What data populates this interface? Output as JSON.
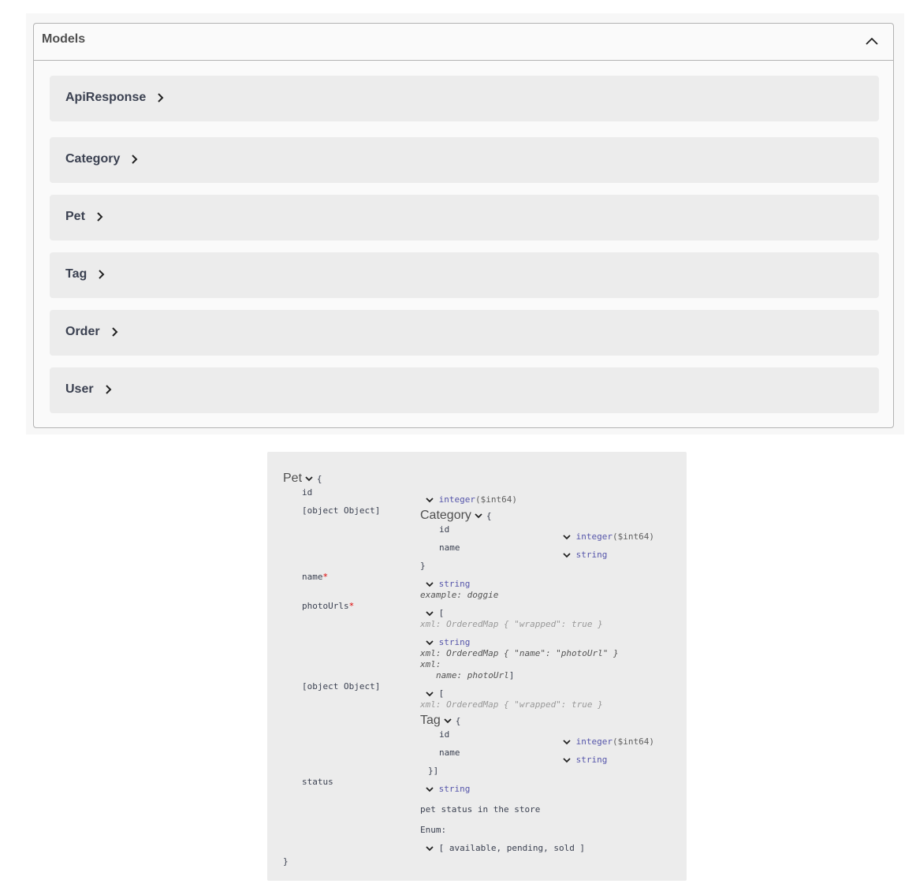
{
  "models_section": {
    "title": "Models",
    "items": [
      {
        "label": "ApiResponse"
      },
      {
        "label": "Category"
      },
      {
        "label": "Pet"
      },
      {
        "label": "Tag"
      },
      {
        "label": "Order"
      },
      {
        "label": "User"
      }
    ]
  },
  "pet_schema": {
    "title": "Pet",
    "open_brace": "{",
    "close_brace": "}",
    "properties": {
      "id": {
        "name": "id",
        "type": "integer",
        "format": "($int64)"
      },
      "category": {
        "name": {
          "name": "name",
          "type": "string"
        },
        "model_title": "Category",
        "open_brace": "{",
        "close_brace": "}",
        "id": {
          "name": "id",
          "type": "integer",
          "format": "($int64)"
        }
      },
      "name": {
        "name": "name",
        "required_mark": "*",
        "type": "string",
        "example": "example: doggie"
      },
      "photoUrls": {
        "name": "photoUrls",
        "required_mark": "*",
        "bracket": "[",
        "xml_wrapped": "xml: OrderedMap { \"wrapped\": true }",
        "item_type": "string",
        "xml_item": "xml: OrderedMap { \"name\": \"photoUrl\" }",
        "xml_label": "xml:",
        "xml_name": "name: photoUrl",
        "close_bracket": "]"
      },
      "tags": {
        "name": {
          "name": "name",
          "type": "string"
        },
        "bracket": "[",
        "xml_wrapped": "xml: OrderedMap { \"wrapped\": true }",
        "model_title": "Tag",
        "open_brace": "{",
        "close": "}]",
        "id": {
          "name": "id",
          "type": "integer",
          "format": "($int64)"
        }
      },
      "status": {
        "name": "status",
        "type": "string",
        "description": "pet status in the store",
        "enum_label": "Enum:",
        "enum_values": "[ available, pending, sold ]"
      }
    }
  }
}
